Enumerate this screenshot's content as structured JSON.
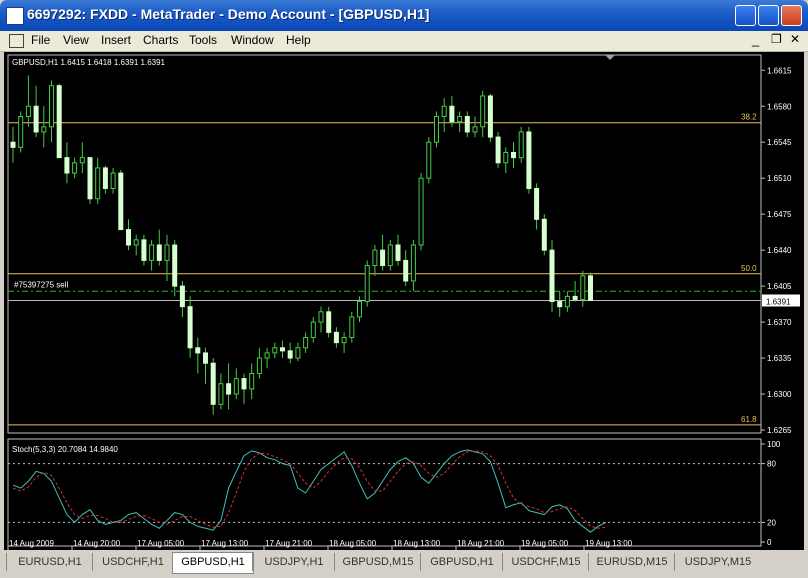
{
  "window": {
    "title": "6697292: FXDD - MetaTrader - Demo Account - [GBPUSD,H1]"
  },
  "menu": [
    "File",
    "View",
    "Insert",
    "Charts",
    "Tools",
    "Window",
    "Help"
  ],
  "colors": {
    "bg": "#000000",
    "candle": "#d8ffd0",
    "wick": "#44cc44",
    "level": "#e8c060",
    "stoch_main": "#40c0c0",
    "stoch_signal": "#d03030"
  },
  "icons": {
    "app": "metatrader-icon",
    "minimize": "minimize-icon",
    "maximize": "maximize-icon",
    "close": "close-icon"
  },
  "chart": {
    "header": "GBPUSD,H1  1.6415 1.6418 1.6391 1.6391",
    "order_label": "#75397275 sell",
    "current_price": "1.6391",
    "price_ticks": [
      "1.6615",
      "1.6580",
      "1.6545",
      "1.6510",
      "1.6475",
      "1.6440",
      "1.6405",
      "1.6370",
      "1.6335",
      "1.6300",
      "1.6265"
    ],
    "fib_levels": [
      {
        "label": "38.2",
        "price": 1.6564
      },
      {
        "label": "50.0",
        "price": 1.6417
      },
      {
        "label": "61.8",
        "price": 1.627
      }
    ],
    "order_price": 1.64,
    "time_labels": [
      "14 Aug 2009",
      "14 Aug 20:00",
      "17 Aug 05:00",
      "17 Aug 13:00",
      "17 Aug 21:00",
      "18 Aug 05:00",
      "18 Aug 13:00",
      "18 Aug 21:00",
      "19 Aug 05:00",
      "19 Aug 13:00"
    ],
    "stoch_header": "Stoch(5,3,3) 20.7084 14.9840",
    "stoch_ticks": [
      "100",
      "80",
      "20",
      "0"
    ]
  },
  "chart_data": {
    "type": "candlestick",
    "title": "GBPUSD,H1",
    "ylim": [
      1.6265,
      1.6625
    ],
    "candles": [
      [
        1.6545,
        1.656,
        1.6525,
        1.654
      ],
      [
        1.654,
        1.6575,
        1.6535,
        1.657
      ],
      [
        1.657,
        1.661,
        1.656,
        1.658
      ],
      [
        1.658,
        1.66,
        1.655,
        1.6555
      ],
      [
        1.6555,
        1.658,
        1.654,
        1.656
      ],
      [
        1.656,
        1.6605,
        1.6545,
        1.66
      ],
      [
        1.66,
        1.6602,
        1.653,
        1.653
      ],
      [
        1.653,
        1.6545,
        1.6505,
        1.6515
      ],
      [
        1.6515,
        1.653,
        1.651,
        1.6525
      ],
      [
        1.6525,
        1.6545,
        1.6515,
        1.653
      ],
      [
        1.653,
        1.653,
        1.6485,
        1.649
      ],
      [
        1.649,
        1.653,
        1.6485,
        1.652
      ],
      [
        1.652,
        1.6522,
        1.6495,
        1.65
      ],
      [
        1.65,
        1.652,
        1.6495,
        1.6515
      ],
      [
        1.6515,
        1.6518,
        1.646,
        1.646
      ],
      [
        1.646,
        1.647,
        1.644,
        1.6445
      ],
      [
        1.6445,
        1.6455,
        1.6435,
        1.645
      ],
      [
        1.645,
        1.6455,
        1.6425,
        1.643
      ],
      [
        1.643,
        1.645,
        1.642,
        1.6445
      ],
      [
        1.6445,
        1.646,
        1.6425,
        1.643
      ],
      [
        1.643,
        1.6455,
        1.641,
        1.6445
      ],
      [
        1.6445,
        1.645,
        1.6395,
        1.6405
      ],
      [
        1.6405,
        1.641,
        1.6375,
        1.6385
      ],
      [
        1.6385,
        1.6395,
        1.6335,
        1.6345
      ],
      [
        1.6345,
        1.6355,
        1.632,
        1.634
      ],
      [
        1.634,
        1.6345,
        1.631,
        1.633
      ],
      [
        1.633,
        1.6335,
        1.628,
        1.629
      ],
      [
        1.629,
        1.632,
        1.6285,
        1.631
      ],
      [
        1.631,
        1.633,
        1.6285,
        1.63
      ],
      [
        1.63,
        1.6325,
        1.6295,
        1.6315
      ],
      [
        1.6315,
        1.632,
        1.629,
        1.6305
      ],
      [
        1.6305,
        1.633,
        1.6295,
        1.632
      ],
      [
        1.632,
        1.6345,
        1.6315,
        1.6335
      ],
      [
        1.6335,
        1.6345,
        1.6325,
        1.634
      ],
      [
        1.634,
        1.635,
        1.6335,
        1.6345
      ],
      [
        1.6345,
        1.6352,
        1.6335,
        1.6342
      ],
      [
        1.6342,
        1.635,
        1.633,
        1.6335
      ],
      [
        1.6335,
        1.635,
        1.6332,
        1.6345
      ],
      [
        1.6345,
        1.636,
        1.634,
        1.6355
      ],
      [
        1.6355,
        1.6375,
        1.635,
        1.637
      ],
      [
        1.637,
        1.6385,
        1.636,
        1.638
      ],
      [
        1.638,
        1.6385,
        1.6355,
        1.636
      ],
      [
        1.636,
        1.6365,
        1.6345,
        1.635
      ],
      [
        1.635,
        1.636,
        1.634,
        1.6355
      ],
      [
        1.6355,
        1.638,
        1.635,
        1.6375
      ],
      [
        1.6375,
        1.6395,
        1.637,
        1.639
      ],
      [
        1.639,
        1.643,
        1.6385,
        1.6425
      ],
      [
        1.6425,
        1.6445,
        1.6415,
        1.644
      ],
      [
        1.644,
        1.6455,
        1.642,
        1.6425
      ],
      [
        1.6425,
        1.645,
        1.642,
        1.6445
      ],
      [
        1.6445,
        1.6455,
        1.6425,
        1.643
      ],
      [
        1.643,
        1.644,
        1.6405,
        1.641
      ],
      [
        1.641,
        1.645,
        1.64,
        1.6445
      ],
      [
        1.6445,
        1.6515,
        1.644,
        1.651
      ],
      [
        1.651,
        1.655,
        1.6505,
        1.6545
      ],
      [
        1.6545,
        1.6575,
        1.654,
        1.657
      ],
      [
        1.657,
        1.6588,
        1.6555,
        1.658
      ],
      [
        1.658,
        1.659,
        1.656,
        1.6565
      ],
      [
        1.6565,
        1.6575,
        1.6555,
        1.657
      ],
      [
        1.657,
        1.6575,
        1.655,
        1.6555
      ],
      [
        1.6555,
        1.657,
        1.655,
        1.656
      ],
      [
        1.656,
        1.6595,
        1.655,
        1.659
      ],
      [
        1.659,
        1.6592,
        1.6545,
        1.655
      ],
      [
        1.655,
        1.6555,
        1.652,
        1.6525
      ],
      [
        1.6525,
        1.654,
        1.6515,
        1.6535
      ],
      [
        1.6535,
        1.6545,
        1.652,
        1.653
      ],
      [
        1.653,
        1.656,
        1.6525,
        1.6555
      ],
      [
        1.6555,
        1.656,
        1.6495,
        1.65
      ],
      [
        1.65,
        1.6505,
        1.646,
        1.647
      ],
      [
        1.647,
        1.6475,
        1.6435,
        1.644
      ],
      [
        1.644,
        1.645,
        1.638,
        1.639
      ],
      [
        1.639,
        1.64,
        1.6375,
        1.6385
      ],
      [
        1.6385,
        1.64,
        1.638,
        1.6395
      ],
      [
        1.6395,
        1.641,
        1.639,
        1.6392
      ],
      [
        1.6392,
        1.642,
        1.6385,
        1.6415
      ],
      [
        1.6415,
        1.6418,
        1.6391,
        1.6391
      ]
    ],
    "stoch_main": [
      58,
      55,
      62,
      72,
      70,
      62,
      45,
      28,
      20,
      28,
      33,
      22,
      18,
      20,
      22,
      28,
      30,
      24,
      18,
      14,
      22,
      30,
      28,
      20,
      16,
      14,
      12,
      22,
      55,
      72,
      88,
      93,
      91,
      86,
      84,
      80,
      78,
      55,
      50,
      62,
      74,
      80,
      86,
      92,
      78,
      60,
      44,
      50,
      62,
      74,
      82,
      86,
      80,
      66,
      60,
      70,
      80,
      88,
      92,
      94,
      92,
      90,
      82,
      60,
      35,
      38,
      40,
      32,
      30,
      28,
      36,
      38,
      34,
      22,
      16,
      10,
      16,
      20
    ],
    "stoch_signal": [
      55,
      52,
      56,
      66,
      71,
      68,
      55,
      40,
      28,
      24,
      27,
      27,
      24,
      20,
      20,
      23,
      26,
      27,
      24,
      20,
      18,
      22,
      26,
      26,
      22,
      18,
      15,
      16,
      30,
      50,
      72,
      85,
      91,
      90,
      87,
      84,
      80,
      70,
      60,
      55,
      62,
      72,
      80,
      86,
      85,
      76,
      62,
      52,
      52,
      62,
      72,
      80,
      82,
      78,
      70,
      66,
      70,
      79,
      87,
      92,
      93,
      92,
      88,
      78,
      60,
      45,
      38,
      36,
      34,
      30,
      31,
      34,
      36,
      32,
      24,
      16,
      14,
      15
    ]
  },
  "tabs": [
    "EURUSD,H1",
    "USDCHF,H1",
    "GBPUSD,H1",
    "USDJPY,H1",
    "GBPUSD,M15",
    "GBPUSD,H1",
    "USDCHF,M15",
    "EURUSD,M15",
    "USDJPY,M15"
  ],
  "active_tab": 2
}
